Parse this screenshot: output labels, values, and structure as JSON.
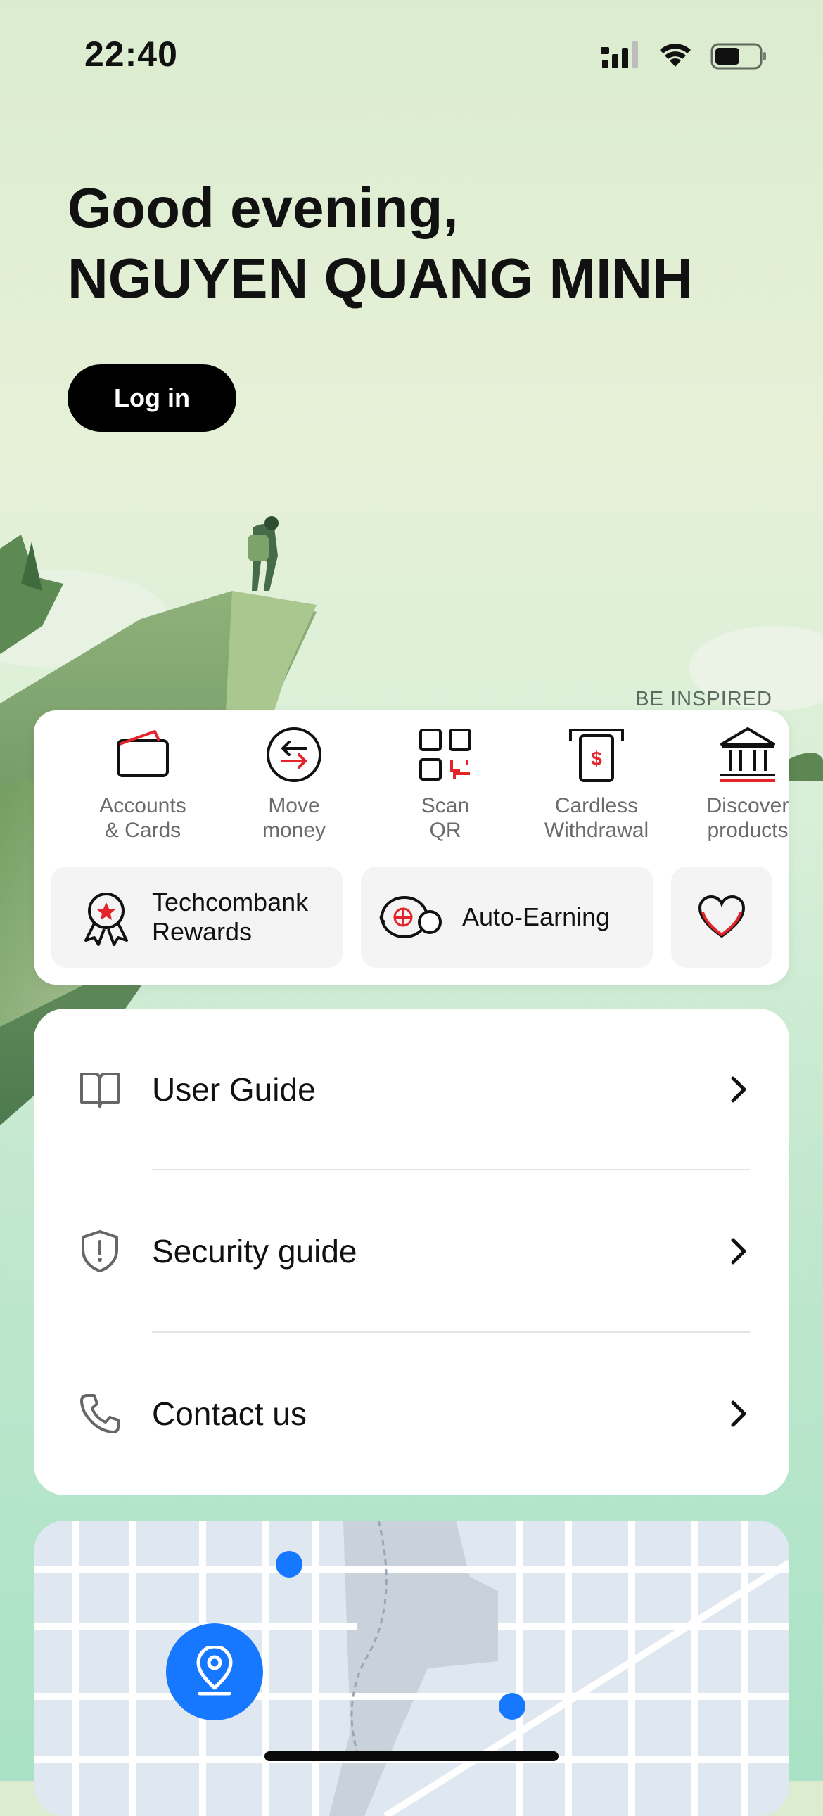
{
  "status_bar": {
    "time": "22:40",
    "battery_level": 0.55
  },
  "greeting": {
    "line1": "Good evening,",
    "line2": "NGUYEN QUANG MINH"
  },
  "login": {
    "label": "Log in"
  },
  "banner": {
    "tag": "BE INSPIRED"
  },
  "quick_actions": [
    {
      "label": "Accounts\n& Cards",
      "icon": "wallet-icon"
    },
    {
      "label": "Move\nmoney",
      "icon": "transfer-icon"
    },
    {
      "label": "Scan\nQR",
      "icon": "qr-icon"
    },
    {
      "label": "Cardless\nWithdrawal",
      "icon": "atm-icon"
    },
    {
      "label": "Discover\nproducts",
      "icon": "bank-icon"
    }
  ],
  "chips": [
    {
      "label": "Techcombank\nRewards",
      "icon": "award-ribbon-icon"
    },
    {
      "label": "Auto-Earning",
      "icon": "coins-icon"
    },
    {
      "label": "",
      "icon": "heart-icon"
    }
  ],
  "guides": [
    {
      "label": "User Guide",
      "icon": "book-icon"
    },
    {
      "label": "Security guide",
      "icon": "shield-alert-icon"
    },
    {
      "label": "Contact us",
      "icon": "phone-icon"
    }
  ],
  "map": {
    "icon": "location-pin-icon"
  },
  "colors": {
    "accent_red": "#e3242b",
    "map_blue": "#1677ff",
    "black": "#000000"
  }
}
